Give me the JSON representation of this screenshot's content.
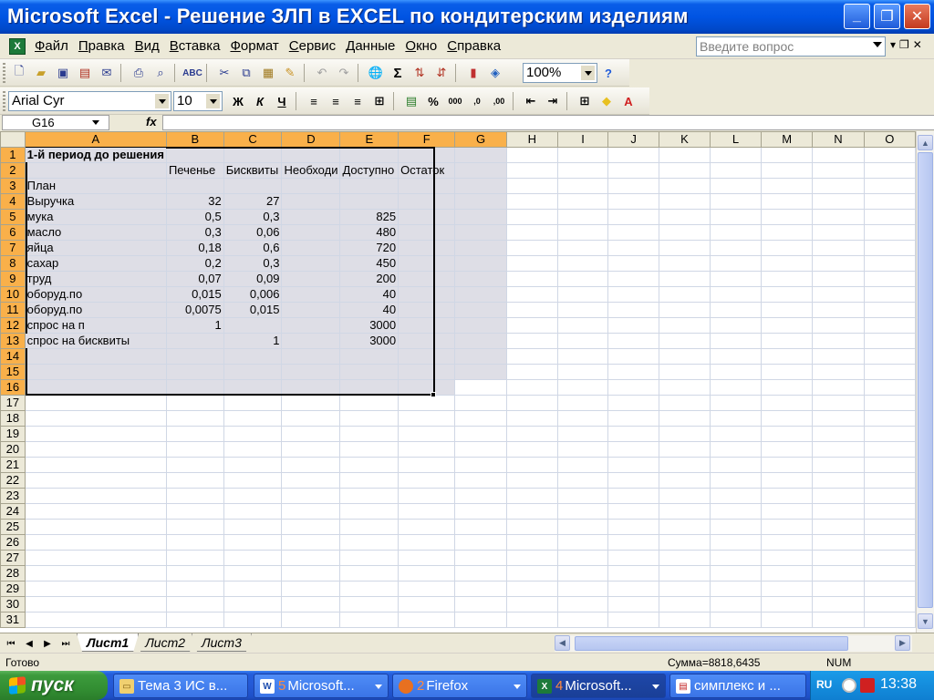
{
  "window": {
    "title": "Microsoft Excel - Решение ЗЛП в EXCEL по кондитерским изделиям"
  },
  "menu": {
    "items": [
      "Файл",
      "Правка",
      "Вид",
      "Вставка",
      "Формат",
      "Сервис",
      "Данные",
      "Окно",
      "Справка"
    ],
    "help_placeholder": "Введите вопрос"
  },
  "toolbar": {
    "zoom": "100%",
    "font_name": "Arial Cyr",
    "font_size": "10",
    "bold_label": "Ж",
    "italic_label": "К",
    "underline_label": "Ч",
    "sigma_label": "Σ"
  },
  "formula_bar": {
    "name_box": "G16",
    "fx_label": "fx",
    "formula": ""
  },
  "sheet": {
    "columns": [
      "A",
      "B",
      "C",
      "D",
      "E",
      "F",
      "G",
      "H",
      "I",
      "J",
      "K",
      "L",
      "M",
      "N",
      "O"
    ],
    "rows": [
      [
        "1-й период до решения",
        "",
        "",
        "",
        "",
        "",
        ""
      ],
      [
        "",
        "Печенье",
        "Бисквиты",
        "Необходи",
        "Доступно",
        "Остаток",
        ""
      ],
      [
        "План",
        "",
        "",
        "",
        "",
        "",
        ""
      ],
      [
        "Выручка",
        "32",
        "27",
        "",
        "",
        "",
        ""
      ],
      [
        "мука",
        "0,5",
        "0,3",
        "",
        "825",
        "",
        ""
      ],
      [
        "масло",
        "0,3",
        "0,06",
        "",
        "480",
        "",
        ""
      ],
      [
        "яйца",
        "0,18",
        "0,6",
        "",
        "720",
        "",
        ""
      ],
      [
        "сахар",
        "0,2",
        "0,3",
        "",
        "450",
        "",
        ""
      ],
      [
        "труд",
        "0,07",
        "0,09",
        "",
        "200",
        "",
        ""
      ],
      [
        "оборуд.по",
        "0,015",
        "0,006",
        "",
        "40",
        "",
        ""
      ],
      [
        "оборуд.по",
        "0,0075",
        "0,015",
        "",
        "40",
        "",
        ""
      ],
      [
        "спрос на п",
        "1",
        "",
        "",
        "3000",
        "",
        ""
      ],
      [
        "спрос на бисквиты",
        "",
        "1",
        "",
        "3000",
        "",
        ""
      ]
    ],
    "visible_row_count": 31,
    "tabs": [
      "Лист1",
      "Лист2",
      "Лист3"
    ],
    "active_tab": "Лист1"
  },
  "status": {
    "ready": "Готово",
    "sum": "Сумма=8818,6435",
    "num": "NUM"
  },
  "taskbar": {
    "start_label": "пуск",
    "tasks": [
      {
        "label": "Тема 3 ИС в...",
        "count": ""
      },
      {
        "label": "Microsoft...",
        "count": "5"
      },
      {
        "label": "Firefox",
        "count": "2"
      },
      {
        "label": "Microsoft...",
        "count": "4"
      },
      {
        "label": "симплекс и ...",
        "count": ""
      }
    ],
    "lang": "RU",
    "clock": "13:38"
  },
  "colors": {
    "selection_fill": "#dedee6",
    "header_highlight": "#f9b04a",
    "titlebar_blue": "#0054e3",
    "start_green": "#338f33"
  }
}
